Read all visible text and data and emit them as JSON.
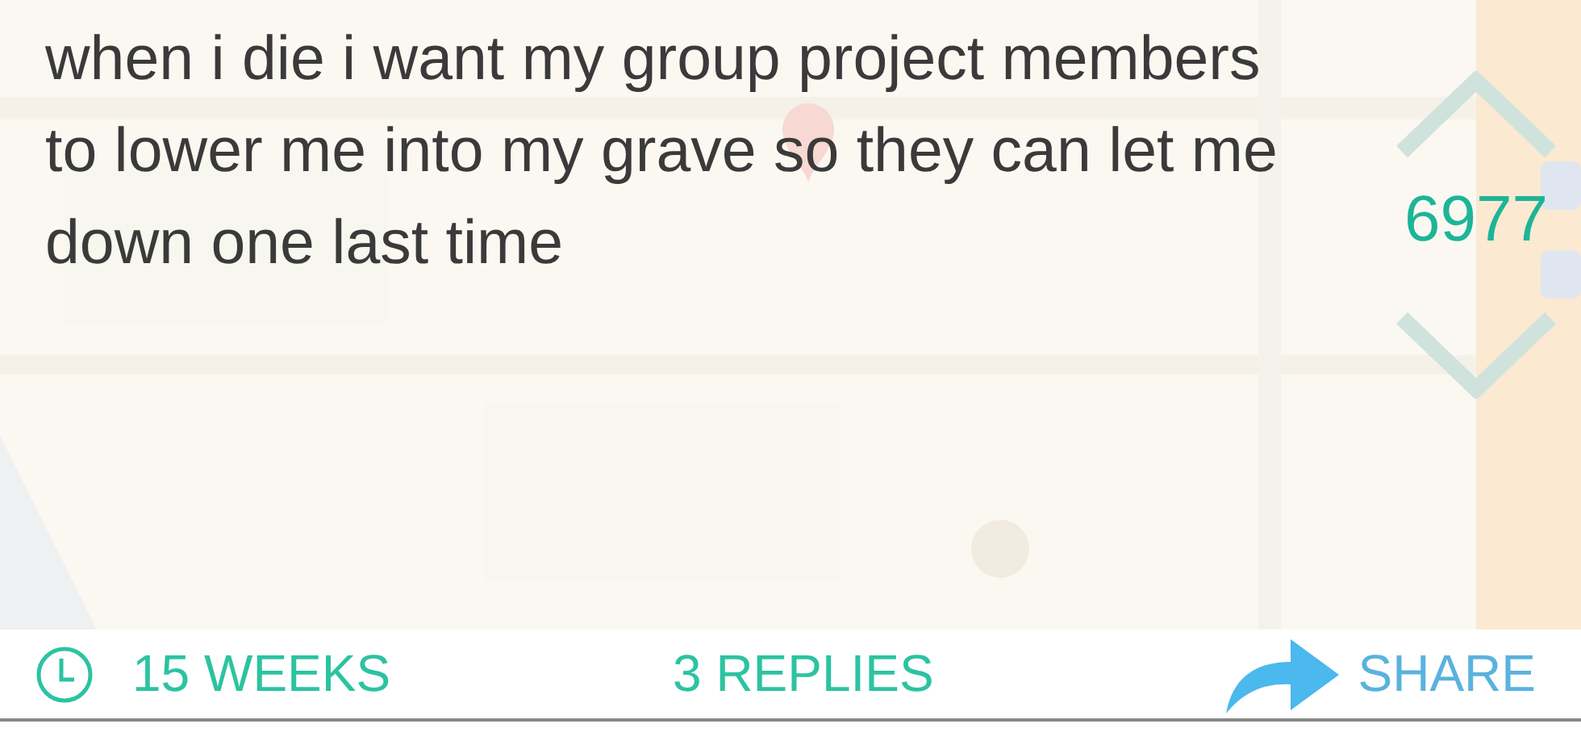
{
  "post": {
    "text": "when i die i want my group project members to lower me into my grave so they can let me down one last time"
  },
  "vote": {
    "score": "6977"
  },
  "footer": {
    "age": "15 WEEKS",
    "replies": "3 REPLIES",
    "share": "SHARE"
  }
}
